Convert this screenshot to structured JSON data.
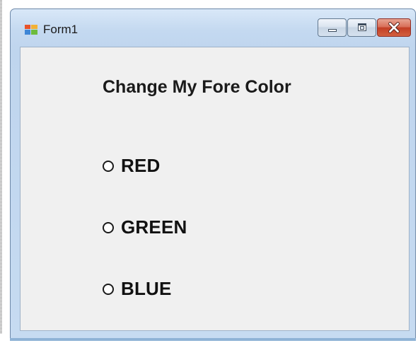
{
  "window": {
    "title": "Form1",
    "icon": "windows-form-icon",
    "controls": {
      "minimize": "minimize-icon",
      "maximize": "maximize-icon",
      "close": "close-icon"
    }
  },
  "form": {
    "heading": "Change My Fore Color",
    "radios": [
      {
        "label": "RED",
        "checked": false
      },
      {
        "label": "GREEN",
        "checked": false
      },
      {
        "label": "BLUE",
        "checked": false
      }
    ]
  },
  "colors": {
    "client_background": "#f0f0f0",
    "close_button": "#c33e25",
    "title_bar": "#c4d9f0"
  }
}
